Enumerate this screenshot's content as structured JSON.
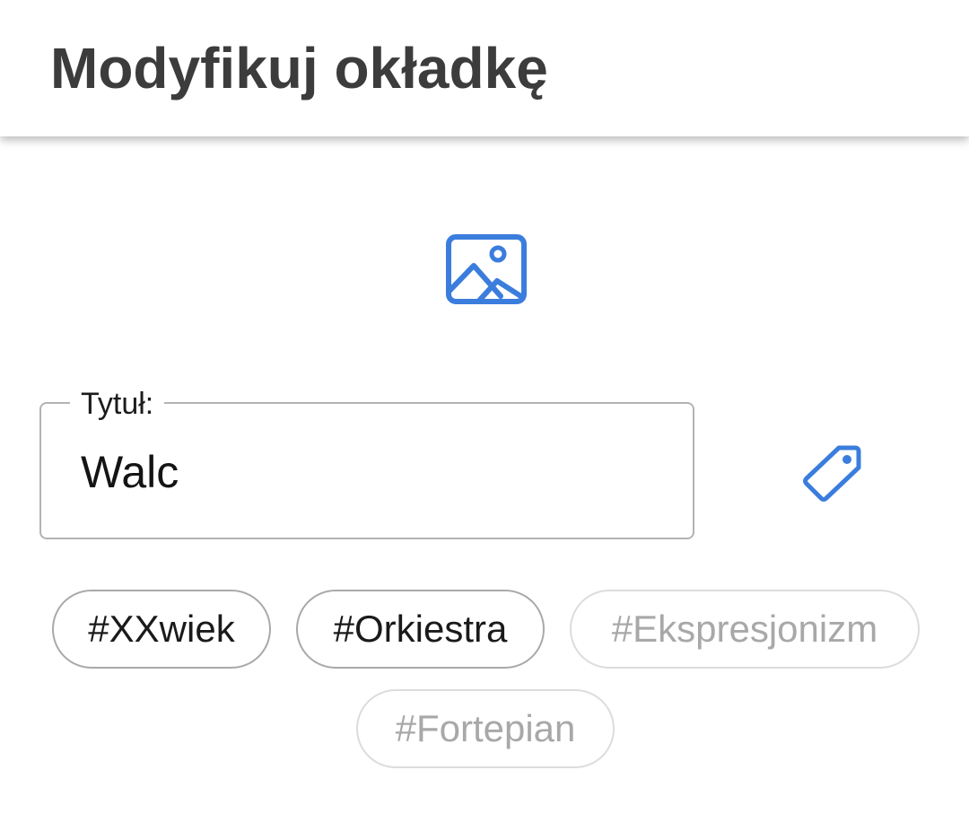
{
  "header": {
    "title": "Modyfikuj okładkę"
  },
  "cover": {
    "icon": "image-icon"
  },
  "title_field": {
    "label": "Tytuł:",
    "value": "Walc"
  },
  "tag_action": {
    "icon": "tag-icon"
  },
  "tags": [
    {
      "label": "#XXwiek",
      "selected": true
    },
    {
      "label": "#Orkiestra",
      "selected": true
    },
    {
      "label": "#Ekspresjonizm",
      "selected": false
    },
    {
      "label": "#Fortepian",
      "selected": false
    }
  ],
  "colors": {
    "accent": "#3b7ddd",
    "title_text": "#3c3c3c",
    "chip_border_selected": "#a9a9a9",
    "chip_border_unselected": "#dcdcdc",
    "chip_text_unselected": "#a8a8a8"
  }
}
